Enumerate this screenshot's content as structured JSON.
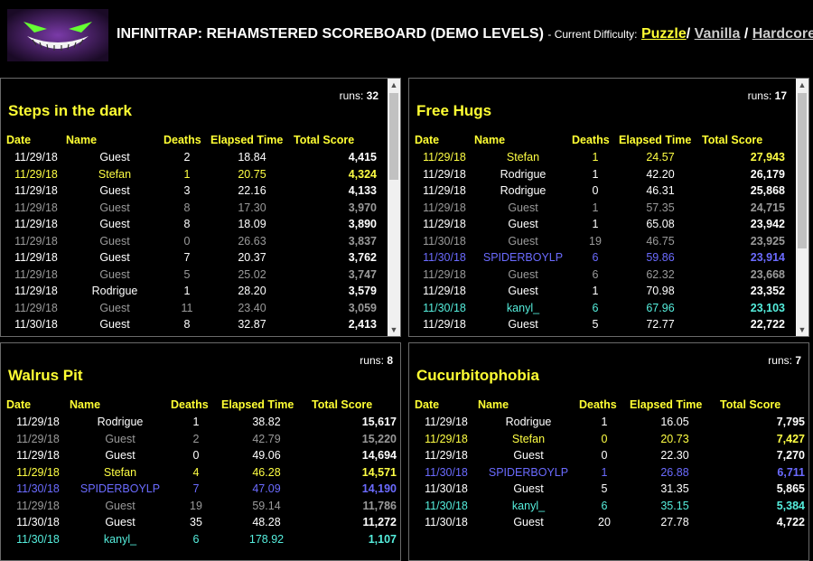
{
  "header": {
    "title": "INFINITRAP: REHAMSTERED SCOREBOARD (DEMO LEVELS)",
    "difficulty_label": "- Current Difficulty:",
    "difficulties": [
      "Puzzle",
      "Vanilla",
      "Hardcore"
    ],
    "separators": [
      "/",
      "/"
    ],
    "active_difficulty": "Puzzle",
    "logo_icon": "grinning-monster-logo"
  },
  "columns": [
    "Date",
    "Name",
    "Deaths",
    "Elapsed Time",
    "Total Score"
  ],
  "colors": {
    "accent": "#ffff33",
    "white": "#ffffff",
    "gray": "#9a9a9a",
    "blue": "#6b6bff",
    "cyan": "#55eedd"
  },
  "panels": [
    {
      "title": "Steps in the dark",
      "runs_label": "runs:",
      "runs": "32",
      "has_scrollbar": true,
      "rows": [
        {
          "date": "11/29/18",
          "name": "Guest",
          "deaths": "2",
          "time": "18.84",
          "score": "4,415",
          "color": "white"
        },
        {
          "date": "11/29/18",
          "name": "Stefan",
          "deaths": "1",
          "time": "20.75",
          "score": "4,324",
          "color": "yellow"
        },
        {
          "date": "11/29/18",
          "name": "Guest",
          "deaths": "3",
          "time": "22.16",
          "score": "4,133",
          "color": "white"
        },
        {
          "date": "11/29/18",
          "name": "Guest",
          "deaths": "8",
          "time": "17.30",
          "score": "3,970",
          "color": "gray"
        },
        {
          "date": "11/29/18",
          "name": "Guest",
          "deaths": "8",
          "time": "18.09",
          "score": "3,890",
          "color": "white"
        },
        {
          "date": "11/29/18",
          "name": "Guest",
          "deaths": "0",
          "time": "26.63",
          "score": "3,837",
          "color": "gray"
        },
        {
          "date": "11/29/18",
          "name": "Guest",
          "deaths": "7",
          "time": "20.37",
          "score": "3,762",
          "color": "white"
        },
        {
          "date": "11/29/18",
          "name": "Guest",
          "deaths": "5",
          "time": "25.02",
          "score": "3,747",
          "color": "gray"
        },
        {
          "date": "11/29/18",
          "name": "Rodrigue",
          "deaths": "1",
          "time": "28.20",
          "score": "3,579",
          "color": "white"
        },
        {
          "date": "11/29/18",
          "name": "Guest",
          "deaths": "11",
          "time": "23.40",
          "score": "3,059",
          "color": "gray"
        },
        {
          "date": "11/30/18",
          "name": "Guest",
          "deaths": "8",
          "time": "32.87",
          "score": "2,413",
          "color": "white"
        }
      ]
    },
    {
      "title": "Free Hugs",
      "runs_label": "runs:",
      "runs": "17",
      "has_scrollbar": true,
      "rows": [
        {
          "date": "11/29/18",
          "name": "Stefan",
          "deaths": "1",
          "time": "24.57",
          "score": "27,943",
          "color": "yellow"
        },
        {
          "date": "11/29/18",
          "name": "Rodrigue",
          "deaths": "1",
          "time": "42.20",
          "score": "26,179",
          "color": "white"
        },
        {
          "date": "11/29/18",
          "name": "Rodrigue",
          "deaths": "0",
          "time": "46.31",
          "score": "25,868",
          "color": "white"
        },
        {
          "date": "11/29/18",
          "name": "Guest",
          "deaths": "1",
          "time": "57.35",
          "score": "24,715",
          "color": "gray"
        },
        {
          "date": "11/29/18",
          "name": "Guest",
          "deaths": "1",
          "time": "65.08",
          "score": "23,942",
          "color": "white"
        },
        {
          "date": "11/30/18",
          "name": "Guest",
          "deaths": "19",
          "time": "46.75",
          "score": "23,925",
          "color": "gray"
        },
        {
          "date": "11/30/18",
          "name": "SPIDERBOYLP",
          "deaths": "6",
          "time": "59.86",
          "score": "23,914",
          "color": "blue"
        },
        {
          "date": "11/29/18",
          "name": "Guest",
          "deaths": "6",
          "time": "62.32",
          "score": "23,668",
          "color": "gray"
        },
        {
          "date": "11/29/18",
          "name": "Guest",
          "deaths": "1",
          "time": "70.98",
          "score": "23,352",
          "color": "white"
        },
        {
          "date": "11/30/18",
          "name": "kanyl_",
          "deaths": "6",
          "time": "67.96",
          "score": "23,103",
          "color": "cyan"
        },
        {
          "date": "11/29/18",
          "name": "Guest",
          "deaths": "5",
          "time": "72.77",
          "score": "22,722",
          "color": "white"
        }
      ]
    },
    {
      "title": "Walrus Pit",
      "runs_label": "runs:",
      "runs": "8",
      "has_scrollbar": false,
      "rows": [
        {
          "date": "11/29/18",
          "name": "Rodrigue",
          "deaths": "1",
          "time": "38.82",
          "score": "15,617",
          "color": "white"
        },
        {
          "date": "11/29/18",
          "name": "Guest",
          "deaths": "2",
          "time": "42.79",
          "score": "15,220",
          "color": "gray"
        },
        {
          "date": "11/29/18",
          "name": "Guest",
          "deaths": "0",
          "time": "49.06",
          "score": "14,694",
          "color": "white"
        },
        {
          "date": "11/29/18",
          "name": "Stefan",
          "deaths": "4",
          "time": "46.28",
          "score": "14,571",
          "color": "yellow"
        },
        {
          "date": "11/30/18",
          "name": "SPIDERBOYLP",
          "deaths": "7",
          "time": "47.09",
          "score": "14,190",
          "color": "blue"
        },
        {
          "date": "11/29/18",
          "name": "Guest",
          "deaths": "19",
          "time": "59.14",
          "score": "11,786",
          "color": "gray"
        },
        {
          "date": "11/30/18",
          "name": "Guest",
          "deaths": "35",
          "time": "48.28",
          "score": "11,272",
          "color": "white"
        },
        {
          "date": "11/30/18",
          "name": "kanyl_",
          "deaths": "6",
          "time": "178.92",
          "score": "1,107",
          "color": "cyan"
        }
      ]
    },
    {
      "title": "Cucurbitophobia",
      "runs_label": "runs:",
      "runs": "7",
      "has_scrollbar": false,
      "rows": [
        {
          "date": "11/29/18",
          "name": "Rodrigue",
          "deaths": "1",
          "time": "16.05",
          "score": "7,795",
          "color": "white"
        },
        {
          "date": "11/29/18",
          "name": "Stefan",
          "deaths": "0",
          "time": "20.73",
          "score": "7,427",
          "color": "yellow"
        },
        {
          "date": "11/29/18",
          "name": "Guest",
          "deaths": "0",
          "time": "22.30",
          "score": "7,270",
          "color": "white"
        },
        {
          "date": "11/30/18",
          "name": "SPIDERBOYLP",
          "deaths": "1",
          "time": "26.88",
          "score": "6,711",
          "color": "blue"
        },
        {
          "date": "11/30/18",
          "name": "Guest",
          "deaths": "5",
          "time": "31.35",
          "score": "5,865",
          "color": "white"
        },
        {
          "date": "11/30/18",
          "name": "kanyl_",
          "deaths": "6",
          "time": "35.15",
          "score": "5,384",
          "color": "cyan"
        },
        {
          "date": "11/30/18",
          "name": "Guest",
          "deaths": "20",
          "time": "27.78",
          "score": "4,722",
          "color": "white"
        }
      ]
    }
  ]
}
